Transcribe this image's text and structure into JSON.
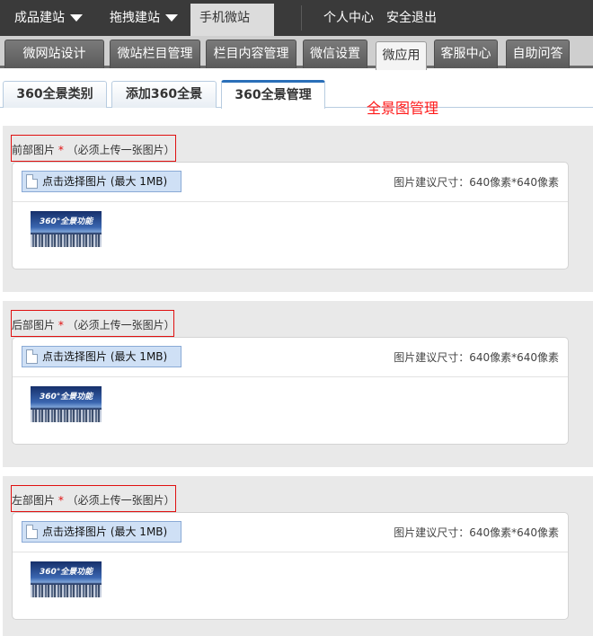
{
  "topnav": {
    "items": [
      {
        "label": "成品建站"
      },
      {
        "label": "拖拽建站"
      },
      {
        "label": "手机微站"
      }
    ],
    "right": [
      "个人中心",
      "安全退出"
    ]
  },
  "subnav": [
    "微网站设计",
    "微站栏目管理",
    "栏目内容管理",
    "微信设置",
    "微应用",
    "客服中心",
    "自助问答"
  ],
  "tabs": [
    "360全景类别",
    "添加360全景",
    "360全景管理"
  ],
  "page_title": "全景图管理",
  "sections": [
    {
      "label": "前部图片",
      "required_mark": "*",
      "note": "（必须上传一张图片）",
      "button": "点击选择图片 (最大 1MB)",
      "size_hint": "图片建议尺寸：640像素*640像素",
      "thumb_text": "360°全景功能"
    },
    {
      "label": "后部图片",
      "required_mark": "*",
      "note": "（必须上传一张图片）",
      "button": "点击选择图片 (最大 1MB)",
      "size_hint": "图片建议尺寸：640像素*640像素",
      "thumb_text": "360°全景功能"
    },
    {
      "label": "左部图片",
      "required_mark": "*",
      "note": "（必须上传一张图片）",
      "button": "点击选择图片 (最大 1MB)",
      "size_hint": "图片建议尺寸：640像素*640像素",
      "thumb_text": "360°全景功能"
    }
  ],
  "colors": {
    "accent_red": "#ff1a1a",
    "topbar": "#3a3a3a",
    "tab_active_border": "#2a6fb8"
  }
}
